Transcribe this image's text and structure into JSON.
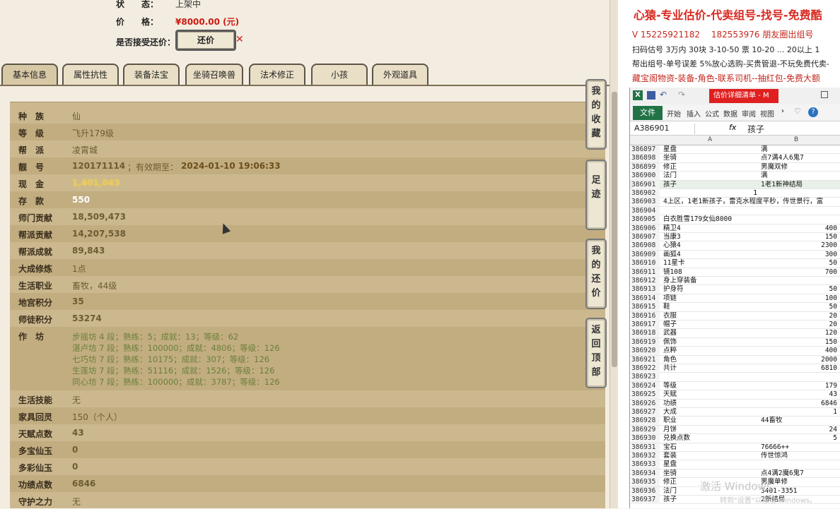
{
  "header": {
    "status_label": "状　　态：",
    "status_value": "上架中",
    "price_label": "价　　格：",
    "price_value": "¥8000.00 (元)",
    "bargain_label": "是否接受还价：",
    "bargain_button": "还价"
  },
  "tabs": [
    "基本信息",
    "属性抗性",
    "装备法宝",
    "坐骑召唤兽",
    "法术修正",
    "小孩",
    "外观道具"
  ],
  "side_buttons": [
    "我的收藏",
    "足迹",
    "我的还价",
    "返回顶部"
  ],
  "info_rows": [
    {
      "k": "种　族",
      "v": "仙"
    },
    {
      "k": "等　级",
      "v": "飞升179级"
    },
    {
      "k": "帮　派",
      "v": "凌霄城"
    },
    {
      "k": "靓　号",
      "v": "120171114",
      "extra": "；有效期至：",
      "extra2": "2024-01-10 19:06:33"
    },
    {
      "k": "现　金",
      "v": "1,401,043"
    },
    {
      "k": "存　款",
      "v": "550"
    },
    {
      "k": "师门贡献",
      "v": "18,509,473"
    },
    {
      "k": "帮派贡献",
      "v": "14,207,538"
    },
    {
      "k": "帮派成就",
      "v": "89,843"
    },
    {
      "k": "大成修炼",
      "v": "1点"
    },
    {
      "k": "生活职业",
      "v": "畜牧，44级"
    },
    {
      "k": "地宫积分",
      "v": "35"
    },
    {
      "k": "师徒积分",
      "v": "53274"
    }
  ],
  "workshop_label": "作　坊",
  "workshop_lines": [
    "步摇坊 4 段；熟练：5；成就：13；等级：62",
    "湛卢坊 7 段；熟练：100000；成就：4806；等级：126",
    "七巧坊 7 段；熟练：10175；成就：307；等级：126",
    "生莲坊 7 段；熟练：51116；成就：1526；等级：126",
    "同心坊 7 段；熟练：100000；成就：3787；等级：126"
  ],
  "info_rows2": [
    {
      "k": "生活技能",
      "v": "无"
    },
    {
      "k": "家具回灵",
      "v": "150（个人）"
    },
    {
      "k": "天赋点数",
      "v": "43"
    },
    {
      "k": "多宝仙玉",
      "v": "0"
    },
    {
      "k": "多彩仙玉",
      "v": "0"
    },
    {
      "k": "功绩点数",
      "v": "6846"
    },
    {
      "k": "守护之力",
      "v": "无"
    }
  ],
  "ad": {
    "title": "心猿-专业估价-代卖组号-找号-免费酷",
    "line1": "V 15225921182 　182553976 朋友圈出组号",
    "line2": "扫码估号 3万内 30块 3-10-50 票 10-20 ... 20以上 1",
    "line3": "帮出组号-单号误差 5%放心选购-买贵管退-不玩免费代卖-",
    "line4": "藏宝阁物资-装备-角色-联系司机--抽红包-免费大额"
  },
  "excel": {
    "title_tab": "估价详细清单 - M",
    "file_tab": "文件",
    "ribbon_tabs": [
      "开始",
      "插入",
      "公式",
      "数据",
      "审阅",
      "视图"
    ],
    "name_box": "A386901",
    "fx": "fx",
    "formula_value": "孩子",
    "col_a": "A",
    "col_b": "B",
    "rows": [
      {
        "n": "386897",
        "a": "星盘",
        "b": "满"
      },
      {
        "n": "386898",
        "a": "坐骑",
        "b": "点7满4人6鬼7"
      },
      {
        "n": "386899",
        "a": "修正",
        "b": "男魔双修"
      },
      {
        "n": "386900",
        "a": "法门",
        "b": "满"
      },
      {
        "n": "386901",
        "a": "孩子",
        "b": "1老1新神结局"
      },
      {
        "n": "386902",
        "a": "",
        "b": "",
        "a_right": "1"
      },
      {
        "n": "386903",
        "a": "4上区，1老1新孩子，雷克水程度平秒，传世景行，富",
        "b": ""
      },
      {
        "n": "386904",
        "a": "",
        "b": ""
      },
      {
        "n": "386905",
        "a": "白衣胜雪179女仙8000",
        "b": ""
      },
      {
        "n": "386906",
        "a": "精卫4",
        "b": "400",
        "num": true
      },
      {
        "n": "386907",
        "a": "当康3",
        "b": "150",
        "num": true
      },
      {
        "n": "386908",
        "a": "心猿4",
        "b": "2300",
        "num": true
      },
      {
        "n": "386909",
        "a": "画狐4",
        "b": "300",
        "num": true
      },
      {
        "n": "386910",
        "a": "11星卡",
        "b": "50",
        "num": true
      },
      {
        "n": "386911",
        "a": "镜108",
        "b": "700",
        "num": true
      },
      {
        "n": "386912",
        "a": "身上穿装备",
        "b": ""
      },
      {
        "n": "386913",
        "a": "护身符",
        "b": "50",
        "num": true
      },
      {
        "n": "386914",
        "a": "项链",
        "b": "100",
        "num": true
      },
      {
        "n": "386915",
        "a": "鞋",
        "b": "50",
        "num": true
      },
      {
        "n": "386916",
        "a": "衣服",
        "b": "20",
        "num": true
      },
      {
        "n": "386917",
        "a": "帽子",
        "b": "20",
        "num": true
      },
      {
        "n": "386918",
        "a": "武器",
        "b": "120",
        "num": true
      },
      {
        "n": "386919",
        "a": "佩饰",
        "b": "150",
        "num": true
      },
      {
        "n": "386920",
        "a": "点粹",
        "b": "400",
        "num": true
      },
      {
        "n": "386921",
        "a": "角色",
        "b": "2000",
        "num": true
      },
      {
        "n": "386922",
        "a": "共计",
        "b": "6810",
        "num": true
      },
      {
        "n": "386923",
        "a": "",
        "b": ""
      },
      {
        "n": "386924",
        "a": "等级",
        "b": "179",
        "num": true
      },
      {
        "n": "386925",
        "a": "天赋",
        "b": "43",
        "num": true
      },
      {
        "n": "386926",
        "a": "功绩",
        "b": "6846",
        "num": true
      },
      {
        "n": "386927",
        "a": "大成",
        "b": "1",
        "num": true
      },
      {
        "n": "386928",
        "a": "职业",
        "b": "44畜牧"
      },
      {
        "n": "386929",
        "a": "月饼",
        "b": "24",
        "num": true
      },
      {
        "n": "386930",
        "a": "兑换点数",
        "b": "5",
        "num": true
      },
      {
        "n": "386931",
        "a": "宝石",
        "b": "76666++"
      },
      {
        "n": "386932",
        "a": "套装",
        "b": "传世惊鸿"
      },
      {
        "n": "386933",
        "a": "星盘",
        "b": ""
      },
      {
        "n": "386934",
        "a": "坐骑",
        "b": "点4满2魔6鬼7"
      },
      {
        "n": "386935",
        "a": "修正",
        "b": "男魔单修"
      },
      {
        "n": "386936",
        "a": "法门",
        "b": "3401-3351"
      },
      {
        "n": "386937",
        "a": "孩子",
        "b": "2新结局"
      }
    ]
  },
  "watermark": "激活 Windows",
  "watermark_sub": "转到\"设置\"以激活 Windows。"
}
